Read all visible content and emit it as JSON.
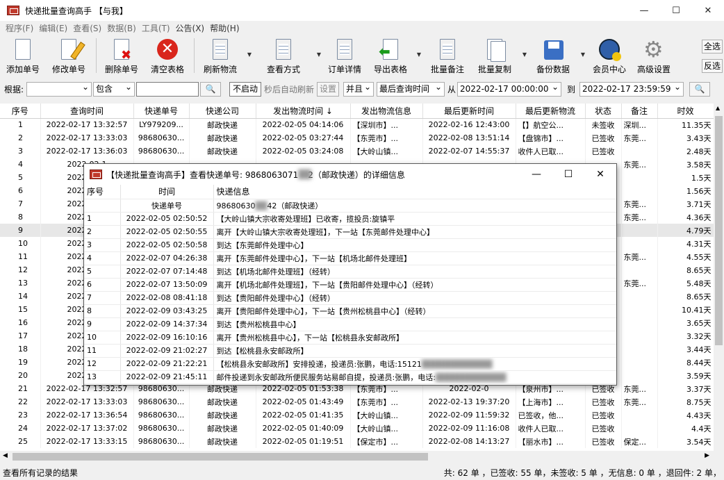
{
  "window": {
    "title": "快递批量查询高手 【与我】"
  },
  "menu": [
    "程序(F)",
    "编辑(E)",
    "查看(S)",
    "数据(B)",
    "工具(T)",
    "公告(X)",
    "帮助(H)"
  ],
  "toolbar": {
    "add": "添加单号",
    "edit": "修改单号",
    "delete": "删除单号",
    "clear": "清空表格",
    "refresh": "刷新物流",
    "view": "查看方式",
    "detail": "订单详情",
    "export": "导出表格",
    "note": "批量备注",
    "copy": "批量复制",
    "backup": "备份数据",
    "member": "会员中心",
    "settings": "高级设置",
    "select_all": "全选",
    "invert": "反选"
  },
  "filter": {
    "root_label": "根据:",
    "contain": "包含",
    "not_start": "不启动",
    "auto_refresh": "秒后自动刷新",
    "set": "设置",
    "and": "并且",
    "last_query": "最后查询时间",
    "from": "从",
    "from_value": "2022-02-17 00:00:00",
    "to": "到",
    "to_value": "2022-02-17 23:59:59"
  },
  "table": {
    "headers": [
      "序号",
      "查询时间",
      "快递单号",
      "快递公司",
      "发出物流时间 ↓",
      "发出物流信息",
      "最后更新时间",
      "最后更新物流",
      "状态",
      "备注",
      "时效"
    ],
    "rows": [
      [
        "1",
        "2022-02-17 13:32:57",
        "LY979209...",
        "邮政快递",
        "2022-02-05 04:14:06",
        "【深圳市】...",
        "2022-02-16 12:43:00",
        "【】航空公...",
        "未签收",
        "深圳...",
        "11.35天"
      ],
      [
        "2",
        "2022-02-17 13:33:03",
        "98680630...",
        "邮政快递",
        "2022-02-05 03:27:44",
        "【东莞市】...",
        "2022-02-08 13:51:14",
        "【盘锦市】...",
        "已签收",
        "东莞...",
        "3.43天"
      ],
      [
        "3",
        "2022-02-17 13:36:03",
        "98680630...",
        "邮政快递",
        "2022-02-05 03:24:08",
        "【大岭山镇...",
        "2022-02-07 14:55:37",
        "收件人已取...",
        "已签收",
        "",
        "2.48天"
      ],
      [
        "4",
        "2022-02-1",
        "",
        "",
        "",
        "",
        "",
        "",
        "",
        "东莞...",
        "3.58天"
      ],
      [
        "5",
        "2022-02-1",
        "",
        "",
        "",
        "",
        "",
        "",
        "",
        "",
        "1.5天"
      ],
      [
        "6",
        "2022-02-1",
        "",
        "",
        "",
        "",
        "",
        "",
        "",
        "",
        "1.56天"
      ],
      [
        "7",
        "2022-02-1",
        "",
        "",
        "",
        "",
        "",
        "",
        "",
        "东莞...",
        "3.71天"
      ],
      [
        "8",
        "2022-02-1",
        "",
        "",
        "",
        "",
        "",
        "",
        "",
        "东莞...",
        "4.36天"
      ],
      [
        "9",
        "2022-02-1",
        "",
        "",
        "",
        "",
        "",
        "",
        "",
        "",
        "4.79天"
      ],
      [
        "10",
        "2022-02-1",
        "",
        "",
        "",
        "",
        "",
        "",
        "",
        "",
        "4.31天"
      ],
      [
        "11",
        "2022-02-1",
        "",
        "",
        "",
        "",
        "",
        "",
        "",
        "东莞...",
        "4.55天"
      ],
      [
        "12",
        "2022-02-1",
        "",
        "",
        "",
        "",
        "",
        "",
        "",
        "",
        "8.65天"
      ],
      [
        "13",
        "2022-02-1",
        "",
        "",
        "",
        "",
        "",
        "",
        "",
        "东莞...",
        "5.48天"
      ],
      [
        "14",
        "2022-02-1",
        "",
        "",
        "",
        "",
        "",
        "",
        "",
        "",
        "8.65天"
      ],
      [
        "15",
        "2022-02-1",
        "",
        "",
        "",
        "",
        "",
        "",
        "",
        "",
        "10.41天"
      ],
      [
        "16",
        "2022-02-1",
        "",
        "",
        "",
        "",
        "",
        "",
        "",
        "",
        "3.65天"
      ],
      [
        "17",
        "2022-02-1",
        "",
        "",
        "",
        "",
        "",
        "",
        "",
        "",
        "3.32天"
      ],
      [
        "18",
        "2022-02-1",
        "",
        "",
        "",
        "",
        "",
        "",
        "",
        "",
        "3.44天"
      ],
      [
        "19",
        "2022-02-1",
        "",
        "",
        "",
        "",
        "",
        "",
        "",
        "",
        "8.44天"
      ],
      [
        "20",
        "2022-02-1",
        "",
        "",
        "",
        "",
        "",
        "",
        "",
        "",
        "3.59天"
      ],
      [
        "21",
        "2022-02-17 13:32:57",
        "98680630...",
        "邮政快递",
        "2022-02-05 01:53:38",
        "【东莞市】...",
        "2022-02-0",
        "【泉州市】...",
        "已签收",
        "东莞...",
        "3.37天"
      ],
      [
        "22",
        "2022-02-17 13:33:03",
        "98680630...",
        "邮政快递",
        "2022-02-05 01:43:49",
        "【东莞市】...",
        "2022-02-13 19:37:20",
        "【上海市】...",
        "已签收",
        "东莞...",
        "8.75天"
      ],
      [
        "23",
        "2022-02-17 13:36:54",
        "98680630...",
        "邮政快递",
        "2022-02-05 01:41:35",
        "【大岭山镇...",
        "2022-02-09 11:59:32",
        "已签收，他...",
        "已签收",
        "",
        "4.43天"
      ],
      [
        "24",
        "2022-02-17 13:37:02",
        "98680630...",
        "邮政快递",
        "2022-02-05 01:40:09",
        "【大岭山镇...",
        "2022-02-09 11:16:08",
        "收件人已取...",
        "已签收",
        "",
        "4.4天"
      ],
      [
        "25",
        "2022-02-17 13:33:15",
        "98680630...",
        "邮政快递",
        "2022-02-05 01:19:51",
        "【保定市】...",
        "2022-02-08 14:13:27",
        "【丽水市】...",
        "已签收",
        "保定...",
        "3.54天"
      ]
    ]
  },
  "status": {
    "left": "查看所有记录的结果",
    "right": "共: 62 单 ，已签收: 55 单，未签收: 5 单 ，无信息: 0 单 ，退回件: 2 单，"
  },
  "popup": {
    "title_prefix": "【快递批量查询高手】查看快递单号: 9868063071",
    "title_suffix": "2（邮政快递）的详细信息",
    "headers": [
      "序号",
      "时间",
      "快递信息"
    ],
    "number_label": "快递单号",
    "number_value": "98680630",
    "number_suffix": "42（邮政快递）",
    "rows": [
      [
        "1",
        "2022-02-05 02:50:52",
        "【大岭山镇大宗收寄处理班】已收寄，揽投员:旋镇平"
      ],
      [
        "2",
        "2022-02-05 02:50:55",
        "离开【大岭山镇大宗收寄处理班】，下一站【东莞邮件处理中心】"
      ],
      [
        "3",
        "2022-02-05 02:50:58",
        "到达【东莞邮件处理中心】"
      ],
      [
        "4",
        "2022-02-07 04:26:38",
        "离开【东莞邮件处理中心】，下一站【机场北邮件处理班】"
      ],
      [
        "5",
        "2022-02-07 07:14:48",
        "到达【机场北邮件处理班】（经转）"
      ],
      [
        "6",
        "2022-02-07 13:50:09",
        "离开【机场北邮件处理班】，下一站【贵阳邮件处理中心】（经转）"
      ],
      [
        "7",
        "2022-02-08 08:41:18",
        "到达【贵阳邮件处理中心】（经转）"
      ],
      [
        "8",
        "2022-02-09 03:43:25",
        "离开【贵阳邮件处理中心】，下一站【贵州松桃县中心】（经转）"
      ],
      [
        "9",
        "2022-02-09 14:37:34",
        "到达【贵州松桃县中心】"
      ],
      [
        "10",
        "2022-02-09 16:10:16",
        "离开【贵州松桃县中心】，下一站【松桃县永安邮政所】"
      ],
      [
        "11",
        "2022-02-09 21:02:27",
        "到达【松桃县永安邮政所】"
      ],
      [
        "12",
        "2022-02-09 21:22:21",
        "【松桃县永安邮政所】安排投递，投递员:张鹏，电话:15121"
      ],
      [
        "13",
        "2022-02-09 21:45:11",
        "邮件投递到永安邮政所便民服务站易邮自提，投递员:张鹏，电话:"
      ]
    ]
  }
}
